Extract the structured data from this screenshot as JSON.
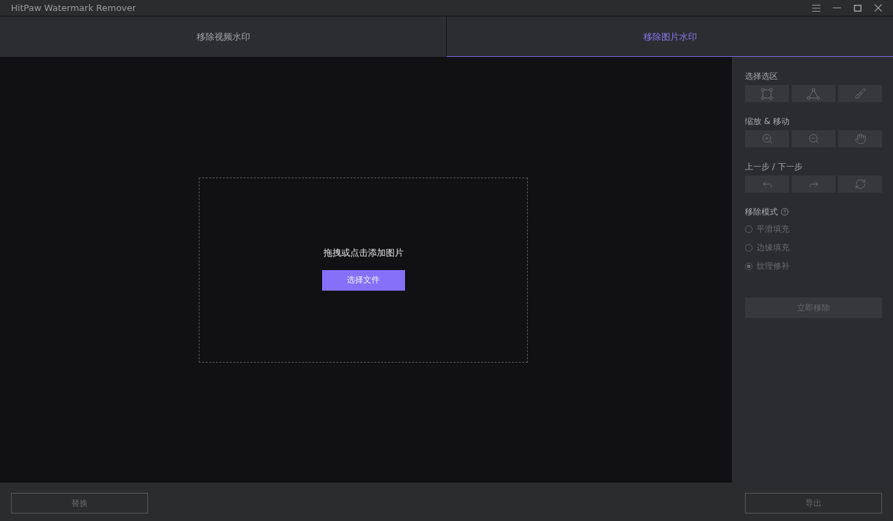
{
  "window": {
    "title": "HitPaw Watermark Remover"
  },
  "tabs": [
    {
      "label": "移除视频水印",
      "selected": false
    },
    {
      "label": "移除图片水印",
      "selected": true
    }
  ],
  "drop_zone": {
    "hint": "拖拽或点击添加图片",
    "button": "选择文件"
  },
  "selection_tools": {
    "label": "选择选区"
  },
  "zoom_tools": {
    "label": "缩放 & 移动"
  },
  "history_tools": {
    "label": "上一步 / 下一步"
  },
  "remove_mode": {
    "label": "移除模式",
    "disabled": true,
    "options": [
      {
        "label": "平滑填充",
        "selected": false
      },
      {
        "label": "边缘填充",
        "selected": false
      },
      {
        "label": "纹理修补",
        "selected": true
      }
    ]
  },
  "remove_button": {
    "label": "立即移除",
    "disabled": true
  },
  "footer": {
    "replace_button": {
      "label": "替换",
      "disabled": true
    },
    "export_button": {
      "label": "导出",
      "disabled": true
    }
  }
}
